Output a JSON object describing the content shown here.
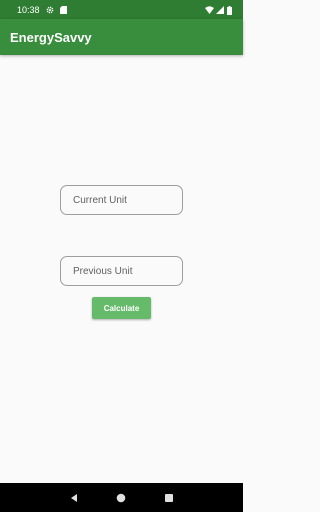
{
  "status_bar": {
    "time": "10:38",
    "icons": [
      "gear-icon",
      "sd-card-icon",
      "wifi-icon",
      "signal-icon",
      "battery-icon"
    ]
  },
  "app_bar": {
    "title": "EnergySavvy",
    "color": "#388e3c"
  },
  "form": {
    "current_unit": {
      "placeholder": "Current Unit",
      "value": ""
    },
    "previous_unit": {
      "placeholder": "Previous Unit",
      "value": ""
    },
    "calculate_label": "Calculate",
    "button_color": "#66bb6a"
  },
  "nav_bar": {
    "icons": [
      "back-icon",
      "home-icon",
      "recents-icon"
    ]
  }
}
